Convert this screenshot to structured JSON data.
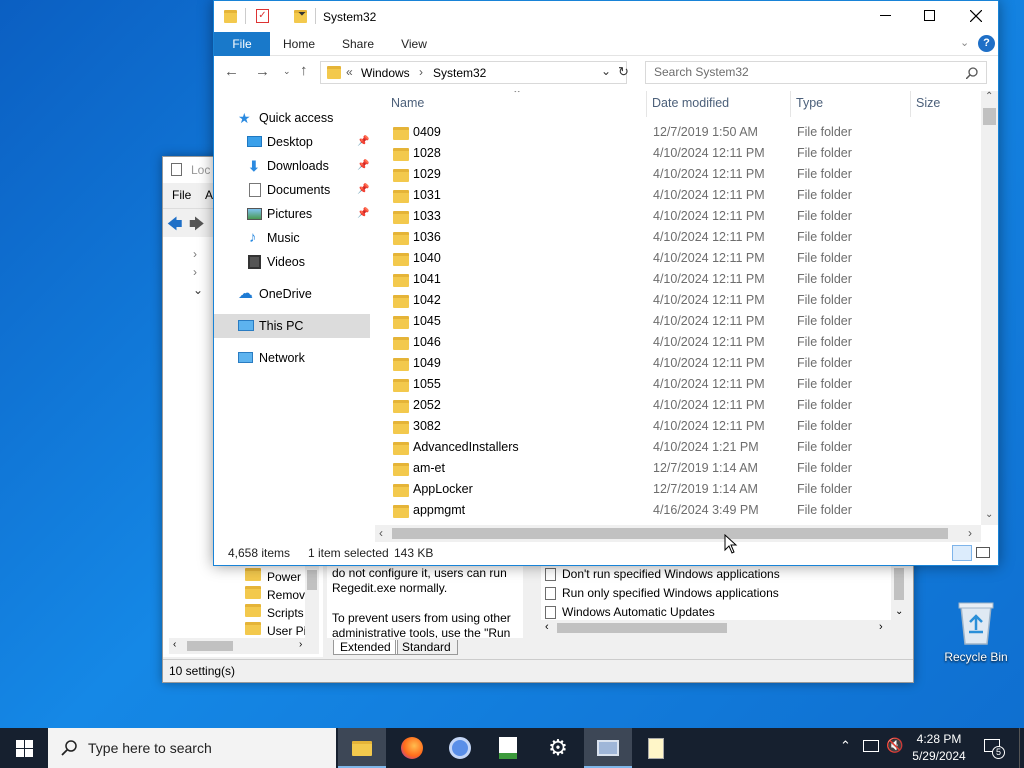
{
  "explorer": {
    "title": "System32",
    "ribbon_tabs": [
      "File",
      "Home",
      "Share",
      "View"
    ],
    "breadcrumb": [
      "Windows",
      "System32"
    ],
    "breadcrumb_prefix": "«",
    "search_placeholder": "Search System32",
    "nav": {
      "quick_access": "Quick access",
      "desktop": "Desktop",
      "downloads": "Downloads",
      "documents": "Documents",
      "pictures": "Pictures",
      "music": "Music",
      "videos": "Videos",
      "onedrive": "OneDrive",
      "this_pc": "This PC",
      "network": "Network"
    },
    "columns": {
      "name": "Name",
      "date": "Date modified",
      "type": "Type",
      "size": "Size"
    },
    "files": [
      {
        "name": "0409",
        "date": "12/7/2019 1:50 AM",
        "type": "File folder"
      },
      {
        "name": "1028",
        "date": "4/10/2024 12:11 PM",
        "type": "File folder"
      },
      {
        "name": "1029",
        "date": "4/10/2024 12:11 PM",
        "type": "File folder"
      },
      {
        "name": "1031",
        "date": "4/10/2024 12:11 PM",
        "type": "File folder"
      },
      {
        "name": "1033",
        "date": "4/10/2024 12:11 PM",
        "type": "File folder"
      },
      {
        "name": "1036",
        "date": "4/10/2024 12:11 PM",
        "type": "File folder"
      },
      {
        "name": "1040",
        "date": "4/10/2024 12:11 PM",
        "type": "File folder"
      },
      {
        "name": "1041",
        "date": "4/10/2024 12:11 PM",
        "type": "File folder"
      },
      {
        "name": "1042",
        "date": "4/10/2024 12:11 PM",
        "type": "File folder"
      },
      {
        "name": "1045",
        "date": "4/10/2024 12:11 PM",
        "type": "File folder"
      },
      {
        "name": "1046",
        "date": "4/10/2024 12:11 PM",
        "type": "File folder"
      },
      {
        "name": "1049",
        "date": "4/10/2024 12:11 PM",
        "type": "File folder"
      },
      {
        "name": "1055",
        "date": "4/10/2024 12:11 PM",
        "type": "File folder"
      },
      {
        "name": "2052",
        "date": "4/10/2024 12:11 PM",
        "type": "File folder"
      },
      {
        "name": "3082",
        "date": "4/10/2024 12:11 PM",
        "type": "File folder"
      },
      {
        "name": "AdvancedInstallers",
        "date": "4/10/2024 1:21 PM",
        "type": "File folder"
      },
      {
        "name": "am-et",
        "date": "12/7/2019 1:14 AM",
        "type": "File folder"
      },
      {
        "name": "AppLocker",
        "date": "12/7/2019 1:14 AM",
        "type": "File folder"
      },
      {
        "name": "appmgmt",
        "date": "4/16/2024 3:49 PM",
        "type": "File folder"
      }
    ],
    "status": {
      "items": "4,658 items",
      "selected": "1 item selected",
      "size": "143 KB"
    }
  },
  "background_window": {
    "title_partial": "Loc",
    "menu": [
      "File",
      "A"
    ],
    "tree_items": [
      "Power",
      "Remov",
      "Scripts",
      "User Pi"
    ],
    "description_lines": [
      "do not configure it, users can run",
      "Regedit.exe normally.",
      "",
      "To prevent users from using other",
      "administrative tools, use the \"Run"
    ],
    "settings": [
      "Don't run specified Windows applications",
      "Run only specified Windows applications",
      "Windows Automatic Updates"
    ],
    "tabs": [
      "Extended",
      "Standard"
    ],
    "status": "10 setting(s)"
  },
  "desktop": {
    "recycle_bin": "Recycle Bin"
  },
  "taskbar": {
    "search_placeholder": "Type here to search",
    "time": "4:28 PM",
    "date": "5/29/2024",
    "notification_count": "5"
  }
}
